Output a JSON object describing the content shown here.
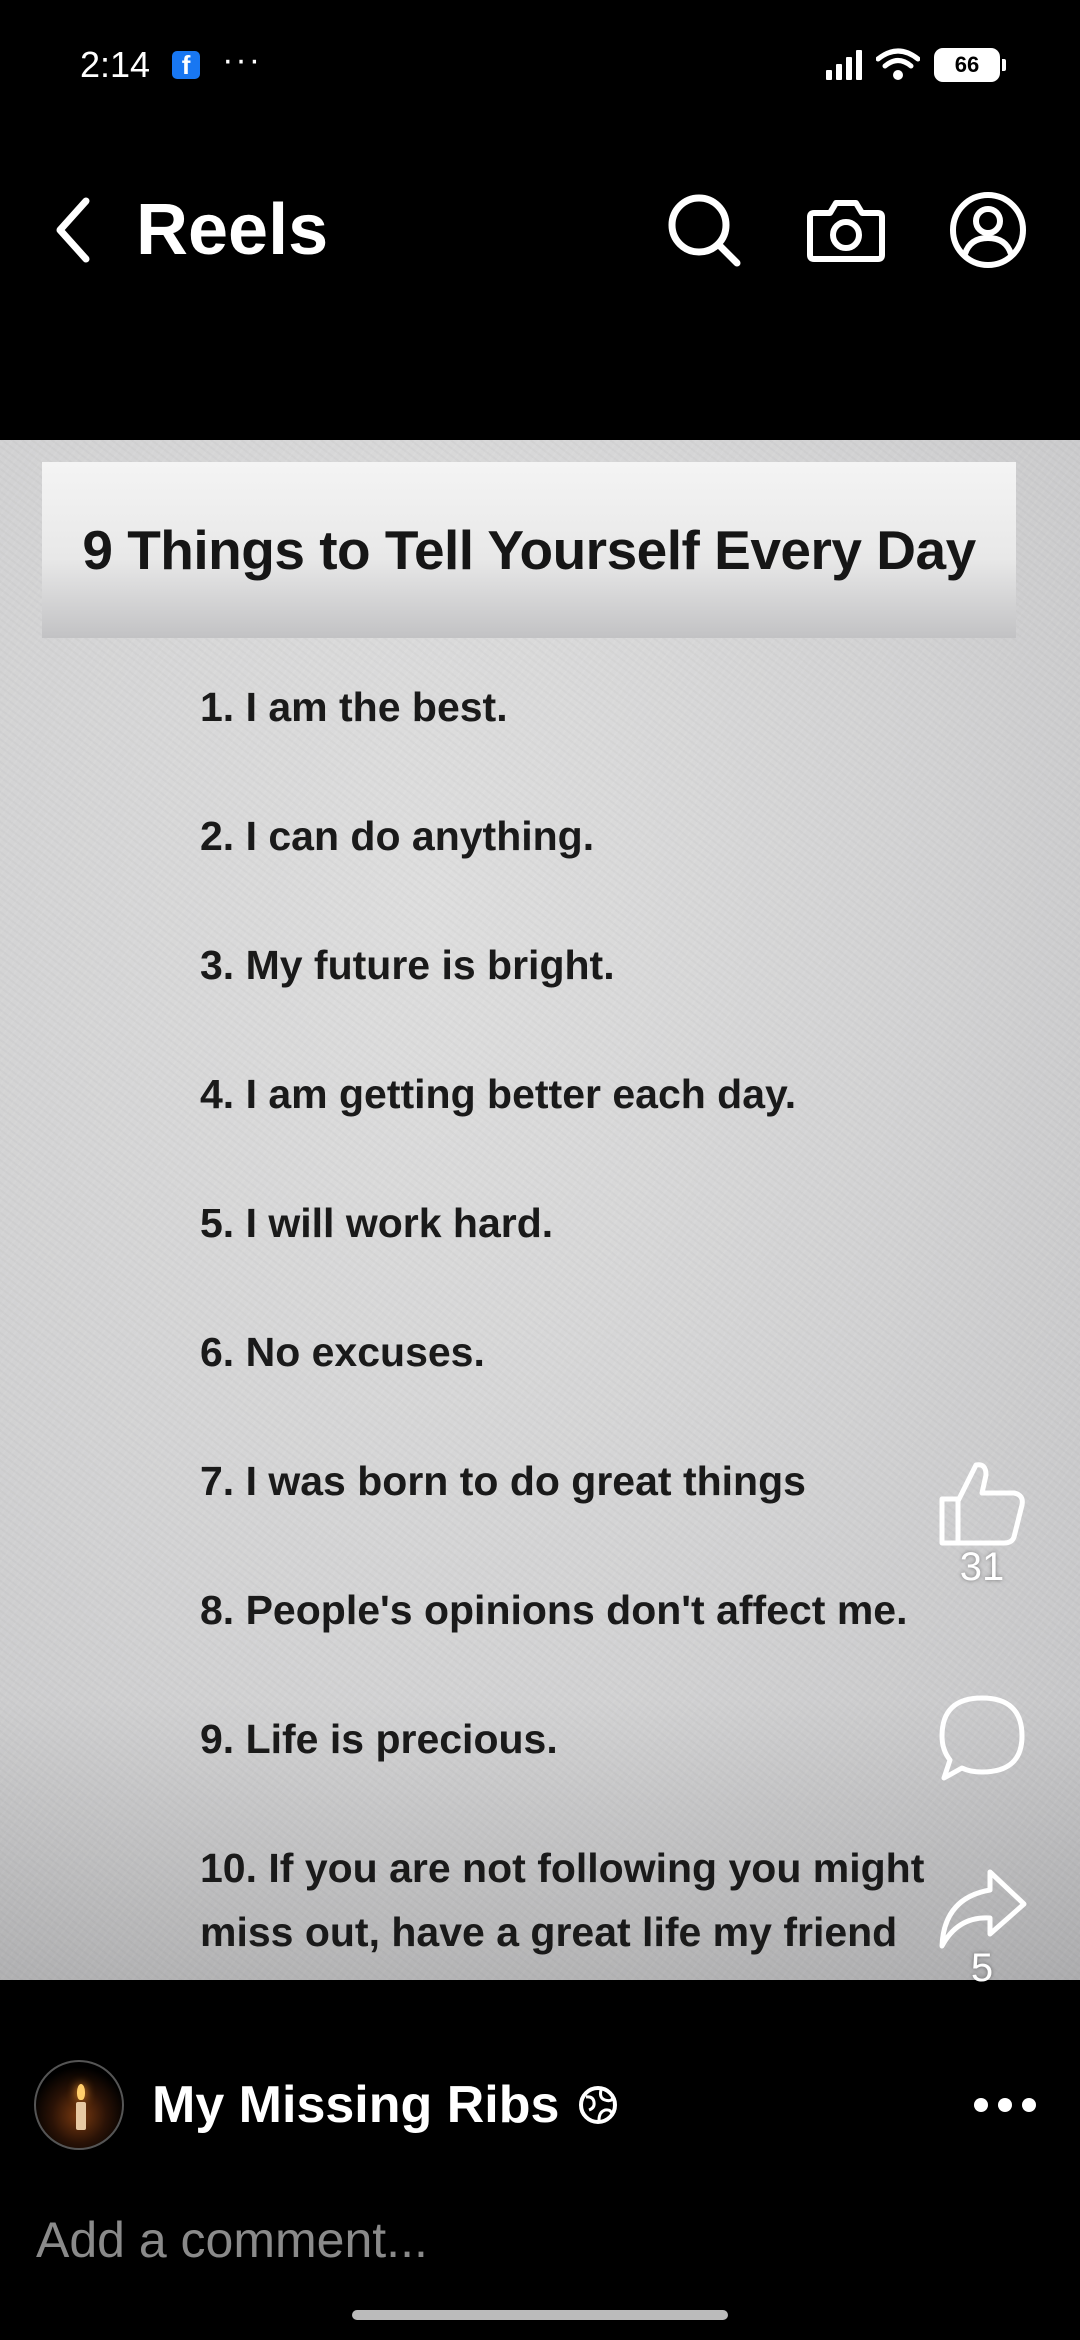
{
  "status_bar": {
    "time": "2:14",
    "notification_app": "f",
    "overflow": "···",
    "battery": "66"
  },
  "header": {
    "title": "Reels",
    "icons": [
      "back-chevron-icon",
      "search-icon",
      "camera-icon",
      "profile-icon"
    ]
  },
  "reel": {
    "title": "9 Things to Tell Yourself Every Day",
    "items": [
      "1. I am the best.",
      "2. I can do anything.",
      "3. My future is bright.",
      "4. I am getting better each day.",
      "5. I will work hard.",
      "6. No excuses.",
      "7. I was born to do great things",
      "8. People's opinions don't affect me.",
      "9. Life is precious.",
      "10. If you are not following you might",
      "miss out, have a great life my friend"
    ]
  },
  "actions": {
    "like_count": "31",
    "share_count": "5"
  },
  "author": {
    "name": "My Missing Ribs"
  },
  "comment": {
    "placeholder": "Add a comment..."
  },
  "colors": {
    "background": "#000000",
    "video_bg": "#d2d2d3",
    "text_dark": "#1a1a1a",
    "placeholder": "#8a8a8a",
    "facebook_blue": "#1877f2"
  }
}
